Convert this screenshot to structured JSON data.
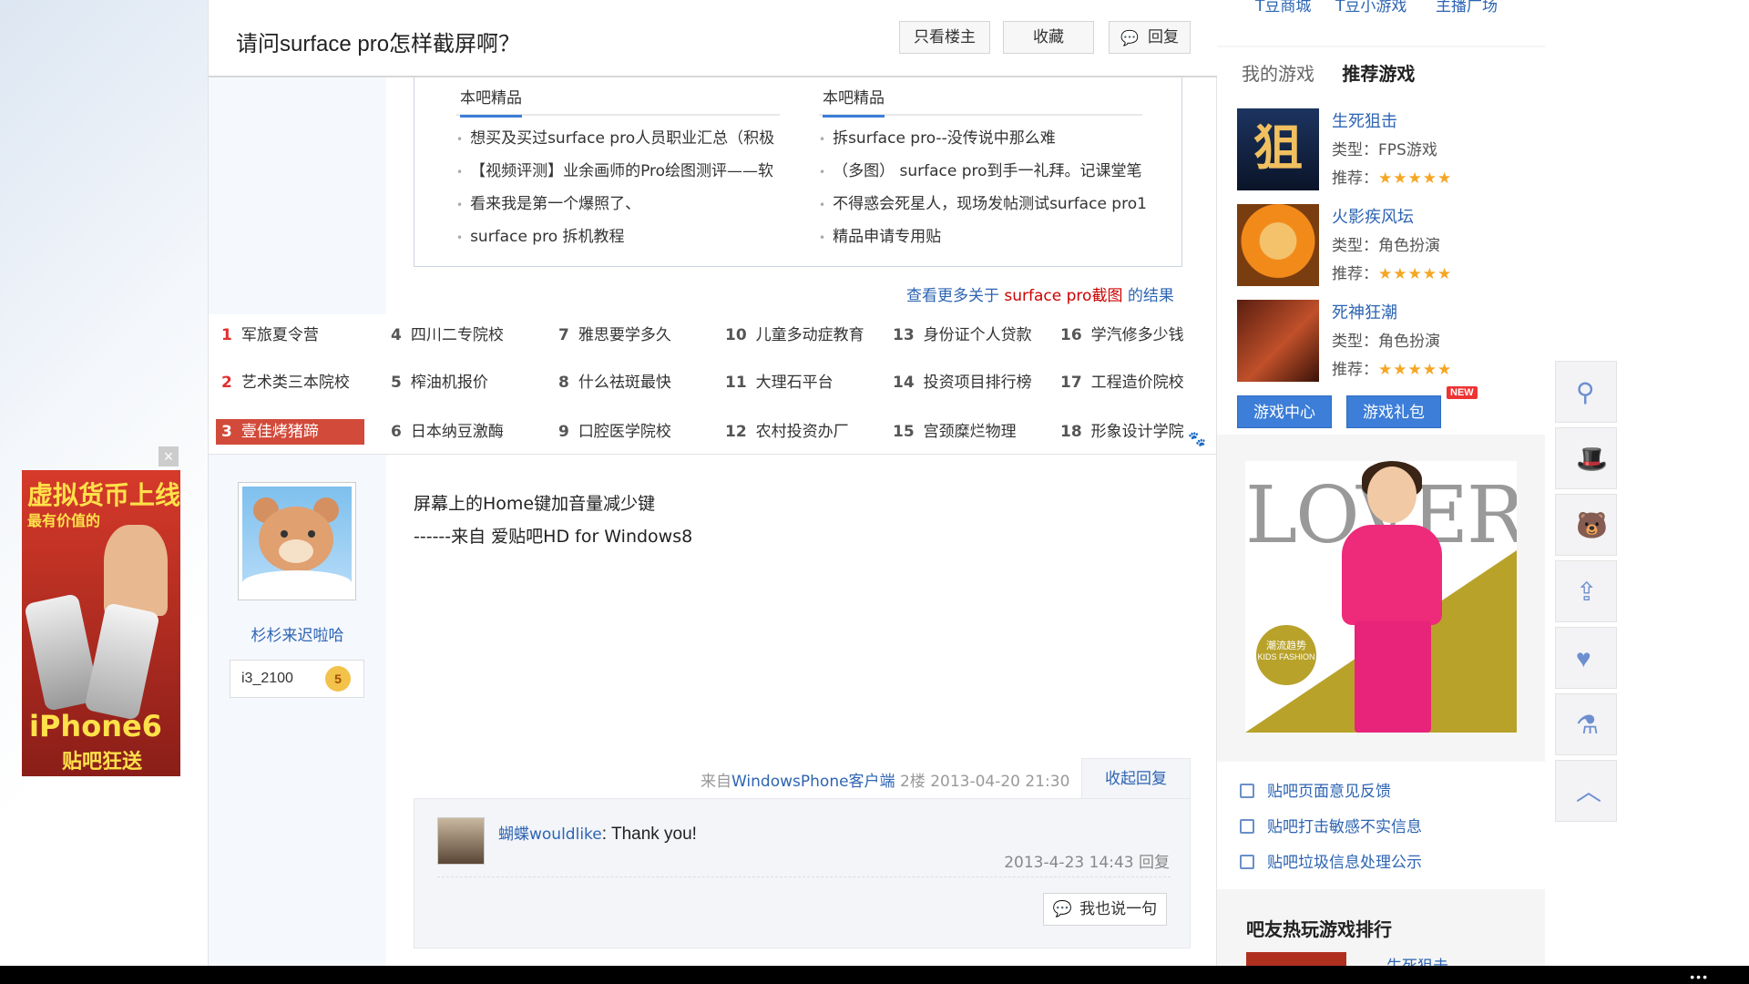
{
  "header": {
    "title": "请问surface pro怎样截屏啊？",
    "btn_louzhu": "只看楼主",
    "btn_fav": "收藏",
    "btn_reply": "回复"
  },
  "jingpin": {
    "left": {
      "heading": "本吧精品",
      "items": [
        "想买及买过surface pro人员职业汇总（积极",
        "【视频评测】业余画师的Pro绘图测评——软",
        "看来我是第一个爆照了、",
        "surface pro 拆机教程"
      ]
    },
    "right": {
      "heading": "本吧精品",
      "items": [
        "拆surface pro--没传说中那么难",
        "（多图） surface pro到手一礼拜。记课堂笔",
        "不得惑会死星人，现场发帖测试surface pro1",
        "精品申请专用贴"
      ]
    },
    "more_prefix": "查看更多关于 ",
    "more_kw": "surface pro截图",
    "more_suffix": " 的结果"
  },
  "hot": [
    {
      "n": "1",
      "t": "军旅夏令营"
    },
    {
      "n": "4",
      "t": "四川二专院校"
    },
    {
      "n": "7",
      "t": "雅思要学多久"
    },
    {
      "n": "10",
      "t": "儿童多动症教育"
    },
    {
      "n": "13",
      "t": "身份证个人贷款"
    },
    {
      "n": "16",
      "t": "学汽修多少钱"
    },
    {
      "n": "2",
      "t": "艺术类三本院校"
    },
    {
      "n": "5",
      "t": "榨油机报价"
    },
    {
      "n": "8",
      "t": "什么祛斑最快"
    },
    {
      "n": "11",
      "t": "大理石平台"
    },
    {
      "n": "14",
      "t": "投资项目排行榜"
    },
    {
      "n": "17",
      "t": "工程造价院校"
    },
    {
      "n": "3",
      "t": "壹佳烤猪蹄"
    },
    {
      "n": "6",
      "t": "日本纳豆激酶"
    },
    {
      "n": "9",
      "t": "口腔医学院校"
    },
    {
      "n": "12",
      "t": "农村投资办厂"
    },
    {
      "n": "15",
      "t": "宫颈糜烂物理"
    },
    {
      "n": "18",
      "t": "形象设计学院"
    }
  ],
  "author": {
    "name": "杉杉来迟啦哈",
    "badge": "i3_2100",
    "level": "5"
  },
  "post": {
    "line1": "屏幕上的Home键加音量减少键",
    "line2": "------来自 爱贴吧HD for Windows8",
    "meta_prefix": "来自",
    "meta_source": "WindowsPhone客户端",
    "meta_floor": "2楼",
    "meta_time": "2013-04-20 21:30",
    "collapse": "收起回复"
  },
  "reply": {
    "name": "蝴蝶wouldlike",
    "text": ": Thank you!",
    "time": "2013-4-23 14:43",
    "reply_label": "回复",
    "say_btn": "我也说一句"
  },
  "sidebar": {
    "top_links": [
      "T豆商城",
      "T豆小游戏",
      "主播广场"
    ],
    "tab_mine": "我的游戏",
    "tab_rec": "推荐游戏",
    "games": [
      {
        "name": "生死狙击",
        "type": "类型：FPS游戏",
        "rec": "推荐：",
        "icon_char": "狙"
      },
      {
        "name": "火影疾风坛",
        "type": "类型：角色扮演",
        "rec": "推荐：",
        "icon_char": ""
      },
      {
        "name": "死神狂潮",
        "type": "类型：角色扮演",
        "rec": "推荐：",
        "icon_char": ""
      }
    ],
    "stars": "★★★★★",
    "btn_center": "游戏中心",
    "btn_gift": "游戏礼包",
    "new_tag": "NEW",
    "ad_word": "LOVERS",
    "ad_badge_line1": "潮流趋势",
    "ad_badge_line2": "KIDS FASHION",
    "feedback": [
      "贴吧页面意见反馈",
      "贴吧打击敏感不实信息",
      "贴吧垃圾信息处理公示"
    ],
    "rank_title": "吧友热玩游戏排行",
    "rank_first": "生死狙击"
  },
  "left_ad": {
    "line1": "虚拟货币上线",
    "line2": "最有价值的",
    "line3": "iPhone6",
    "line4": "贴吧狂送",
    "close": "×"
  },
  "floatbar": [
    "location-icon",
    "gift-hat-icon",
    "bear-icon",
    "share-icon",
    "heart-icon",
    "flask-icon",
    "back-to-top-icon"
  ],
  "taskbar_dots": "•••"
}
